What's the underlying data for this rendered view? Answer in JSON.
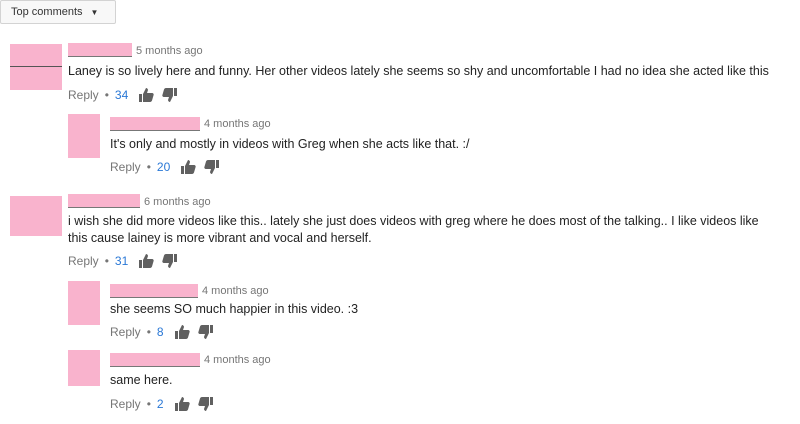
{
  "sort": {
    "label": "Top comments"
  },
  "comments": [
    {
      "time": "5 months ago",
      "text": "Laney is so lively here and funny.   Her other videos lately she seems so shy and uncomfortable I had no idea she acted like this",
      "reply": "Reply",
      "likes": "34"
    },
    {
      "time": "4 months ago",
      "text": "It's only and mostly in videos with Greg when she acts like that. :/",
      "reply": "Reply",
      "likes": "20"
    },
    {
      "time": "6 months ago",
      "text_line1": "i wish she did more videos like this.. lately she just does videos with greg where he does most of the talking.. I like videos like",
      "text_line2": "this cause lainey is more vibrant and vocal and herself.",
      "reply": "Reply",
      "likes": "31"
    },
    {
      "time": "4 months ago",
      "text": "she seems SO much happier in this video. :3",
      "reply": "Reply",
      "likes": "8"
    },
    {
      "time": "4 months ago",
      "text": "same here.",
      "reply": "Reply",
      "likes": "2"
    }
  ],
  "separator": "•",
  "colors": {
    "avatar": "#f9b3cd",
    "link": "#2a78d6",
    "meta": "#767676"
  },
  "icons": [
    "thumbs-up-icon",
    "thumbs-down-icon",
    "chevron-down-icon"
  ]
}
